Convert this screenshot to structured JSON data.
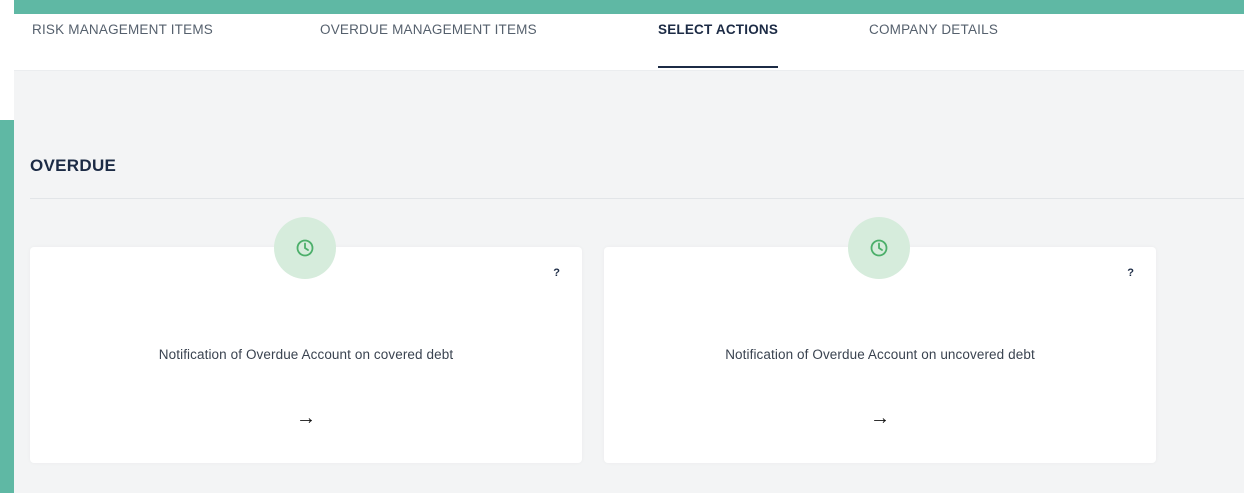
{
  "tabs": [
    {
      "label": "RISK MANAGEMENT ITEMS",
      "active": false
    },
    {
      "label": "OVERDUE MANAGEMENT ITEMS",
      "active": false
    },
    {
      "label": "SELECT ACTIONS",
      "active": true
    },
    {
      "label": "COMPANY DETAILS",
      "active": false
    }
  ],
  "section": {
    "title": "OVERDUE"
  },
  "cards": [
    {
      "icon": "clock-icon",
      "help": "?",
      "title": "Notification of Overdue Account on covered debt",
      "arrow": "→"
    },
    {
      "icon": "clock-icon",
      "help": "?",
      "title": "Notification of Overdue Account on uncovered debt",
      "arrow": "→"
    }
  ],
  "colors": {
    "frame": "#5fb8a4",
    "accent_navy": "#1c2b45",
    "icon_green": "#4caf6a",
    "icon_bg": "#d6ecdc"
  }
}
